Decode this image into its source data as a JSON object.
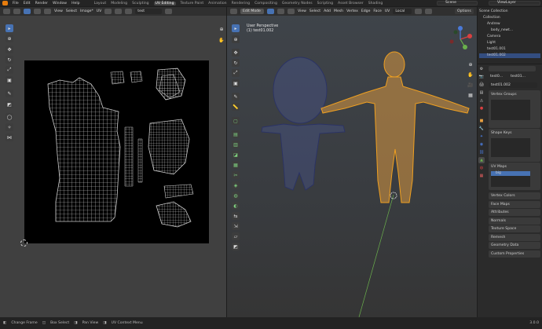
{
  "menu": {
    "items": [
      "File",
      "Edit",
      "Render",
      "Window",
      "Help"
    ],
    "workspaces": [
      "Layout",
      "Modeling",
      "Sculpting",
      "UV Editing",
      "Texture Paint",
      "Animation",
      "Rendering",
      "Compositing",
      "Geometry Nodes",
      "Scripting",
      "Asset Browser",
      "Shading"
    ],
    "active_workspace": "UV Editing",
    "scene": "Scene",
    "view_layer": "ViewLayer"
  },
  "uv_editor": {
    "menus": [
      "View",
      "Select",
      "Image*",
      "UV"
    ],
    "image_name": "test"
  },
  "viewport": {
    "mode": "Edit Mode",
    "menus": [
      "View",
      "Select",
      "Add",
      "Mesh",
      "Vertex",
      "Edge",
      "Face",
      "UV"
    ],
    "orientation": "Local",
    "options": "Options",
    "view_name": "User Perspective",
    "object_label": "(1) test01.002"
  },
  "outliner": {
    "title": "Scene Collection",
    "rows": [
      {
        "label": "Scene Collection",
        "highlight": false,
        "indent": 0
      },
      {
        "label": "Collection",
        "highlight": false,
        "indent": 1
      },
      {
        "label": "Andrew",
        "highlight": false,
        "indent": 2
      },
      {
        "label": "body_newt...",
        "highlight": false,
        "indent": 3
      },
      {
        "label": "Camera",
        "highlight": false,
        "indent": 2
      },
      {
        "label": "Light",
        "highlight": false,
        "indent": 2
      },
      {
        "label": "test01.001",
        "highlight": false,
        "indent": 2
      },
      {
        "label": "test01.002",
        "highlight": true,
        "indent": 2
      }
    ]
  },
  "properties": {
    "object_path": "test0...",
    "object_sub": "test01...",
    "mesh_name": "test01.002",
    "panels": {
      "vertex_groups": "Vertex Groups",
      "shape_keys": "Shape Keys",
      "uv_maps": "UV Maps",
      "uv_map_item": "big"
    },
    "collapsed": [
      "Vertex Colors",
      "Face Maps",
      "Attributes",
      "Normals",
      "Texture Space",
      "Remesh",
      "Geometry Data",
      "Custom Properties"
    ]
  },
  "status": {
    "items": [
      "Change Frame",
      "Box Select",
      "Pan View",
      "UV Context Menu"
    ],
    "version": "3.0.0"
  },
  "colors": {
    "accent_blue": "#4772b3",
    "active_mesh": "#f0a020",
    "inactive_mesh": "#2a3266"
  }
}
